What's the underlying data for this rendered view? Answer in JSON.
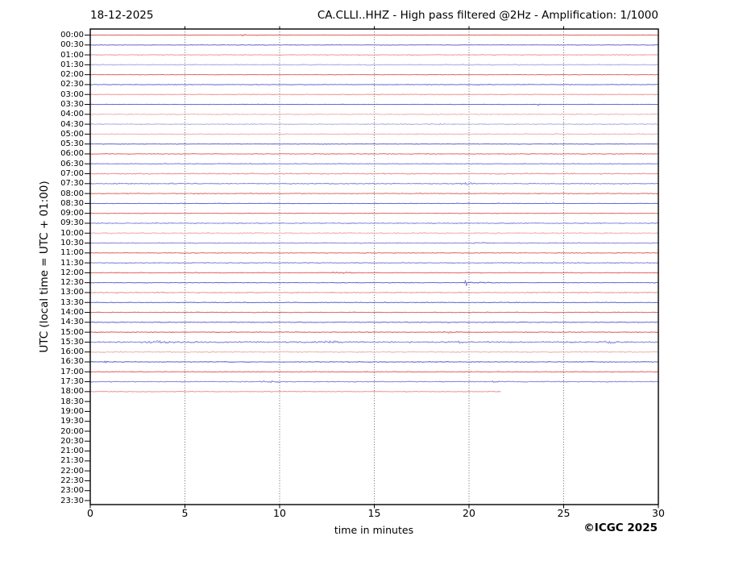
{
  "header": {
    "date": "18-12-2025",
    "title": "CA.CLLI..HHZ - High pass filtered @2Hz - Amplification: 1/1000"
  },
  "y_axis": {
    "title": "UTC (local time = UTC + 01:00)",
    "tick_labels": [
      "00:00",
      "00:30",
      "01:00",
      "01:30",
      "02:00",
      "02:30",
      "03:00",
      "03:30",
      "04:00",
      "04:30",
      "05:00",
      "05:30",
      "06:00",
      "06:30",
      "07:00",
      "07:30",
      "08:00",
      "08:30",
      "09:00",
      "09:30",
      "10:00",
      "10:30",
      "11:00",
      "11:30",
      "12:00",
      "12:30",
      "13:00",
      "13:30",
      "14:00",
      "14:30",
      "15:00",
      "15:30",
      "16:00",
      "16:30",
      "17:00",
      "17:30",
      "18:00",
      "18:30",
      "19:00",
      "19:30",
      "20:00",
      "20:30",
      "21:00",
      "21:30",
      "22:00",
      "22:30",
      "23:00",
      "23:30"
    ]
  },
  "x_axis": {
    "title": "time in minutes",
    "ticks": [
      "0",
      "5",
      "10",
      "15",
      "20",
      "25",
      "30"
    ],
    "min": 0,
    "max": 30,
    "gridlines_min": [
      5,
      10,
      15,
      20,
      25
    ]
  },
  "footer": {
    "copyright": "©ICGC 2025"
  },
  "colors": {
    "red": "#d84040",
    "midred": "#e87878",
    "pink": "#f0a0a0",
    "blue": "#4040c8",
    "midblue": "#6868d4",
    "lightblue": "#9898e0",
    "grid": "#555555",
    "axis": "#000000"
  },
  "chart_data": {
    "type": "line",
    "subtype": "helicorder-dayplot",
    "minutes_per_line": 30,
    "x_range_minutes": [
      0,
      30
    ],
    "rows": [
      {
        "label": "00:00",
        "color": "red",
        "amp": 0.45,
        "events": [
          {
            "t": 8.1,
            "s": 0.08,
            "a": 1.6
          }
        ]
      },
      {
        "label": "00:30",
        "color": "blue",
        "amp": 0.45,
        "events": [
          {
            "t": 10.85,
            "s": 0.07,
            "a": 1.8
          }
        ]
      },
      {
        "label": "01:00",
        "color": "midred",
        "amp": 0.5
      },
      {
        "label": "01:30",
        "color": "lightblue",
        "amp": 0.75
      },
      {
        "label": "02:00",
        "color": "red",
        "amp": 0.45,
        "events": [
          {
            "t": 27.0,
            "s": 0.09,
            "a": 1.1
          }
        ]
      },
      {
        "label": "02:30",
        "color": "blue",
        "amp": 0.5
      },
      {
        "label": "03:00",
        "color": "midred",
        "amp": 0.5
      },
      {
        "label": "03:30",
        "color": "blue",
        "amp": 0.45,
        "events": [
          {
            "t": 23.65,
            "s": 0.07,
            "a": 1.7
          }
        ]
      },
      {
        "label": "04:00",
        "color": "pink",
        "amp": 0.8
      },
      {
        "label": "04:30",
        "color": "lightblue",
        "amp": 0.7,
        "events": [
          {
            "t": 18.55,
            "s": 0.12,
            "a": 1.1
          }
        ]
      },
      {
        "label": "05:00",
        "color": "pink",
        "amp": 0.75
      },
      {
        "label": "05:30",
        "color": "blue",
        "amp": 0.5
      },
      {
        "label": "06:00",
        "color": "red",
        "amp": 0.55
      },
      {
        "label": "06:30",
        "color": "midblue",
        "amp": 0.65
      },
      {
        "label": "07:00",
        "color": "midred",
        "amp": 0.85
      },
      {
        "label": "07:30",
        "color": "midblue",
        "amp": 0.7,
        "events": [
          {
            "t": 4.3,
            "s": 0.08,
            "a": 0.9
          },
          {
            "t": 19.9,
            "s": 0.35,
            "a": 1.1
          }
        ]
      },
      {
        "label": "08:00",
        "color": "red",
        "amp": 0.55
      },
      {
        "label": "08:30",
        "color": "blue",
        "amp": 0.5
      },
      {
        "label": "09:00",
        "color": "red",
        "amp": 0.45
      },
      {
        "label": "09:30",
        "color": "midblue",
        "amp": 0.75
      },
      {
        "label": "10:00",
        "color": "pink",
        "amp": 0.95
      },
      {
        "label": "10:30",
        "color": "midblue",
        "amp": 0.65,
        "events": [
          {
            "t": 20.8,
            "s": 0.4,
            "a": 1.1
          }
        ]
      },
      {
        "label": "11:00",
        "color": "red",
        "amp": 0.55
      },
      {
        "label": "11:30",
        "color": "midblue",
        "amp": 0.7
      },
      {
        "label": "12:00",
        "color": "red",
        "amp": 0.6,
        "events": [
          {
            "t": 13.2,
            "s": 0.7,
            "a": 0.7
          }
        ]
      },
      {
        "label": "12:30",
        "color": "blue",
        "amp": 0.5,
        "events": [
          {
            "t": 19.85,
            "s": 0.06,
            "a": 4.2
          },
          {
            "t": 20.6,
            "s": 0.5,
            "a": 0.7
          }
        ]
      },
      {
        "label": "13:00",
        "color": "midred",
        "amp": 0.8
      },
      {
        "label": "13:30",
        "color": "blue",
        "amp": 0.55
      },
      {
        "label": "14:00",
        "color": "red",
        "amp": 0.6
      },
      {
        "label": "14:30",
        "color": "blue",
        "amp": 0.55
      },
      {
        "label": "15:00",
        "color": "red",
        "amp": 0.6,
        "events": [
          {
            "t": 19.0,
            "s": 0.5,
            "a": 0.6
          }
        ]
      },
      {
        "label": "15:30",
        "color": "midblue",
        "amp": 0.95,
        "events": [
          {
            "t": 3.6,
            "s": 0.8,
            "a": 1.1
          },
          {
            "t": 12.7,
            "s": 0.45,
            "a": 1.7
          },
          {
            "t": 19.4,
            "s": 0.4,
            "a": 0.9
          },
          {
            "t": 25.2,
            "s": 0.3,
            "a": 0.7
          },
          {
            "t": 27.4,
            "s": 0.4,
            "a": 1.1
          }
        ]
      },
      {
        "label": "16:00",
        "color": "pink",
        "amp": 0.95
      },
      {
        "label": "16:30",
        "color": "blue",
        "amp": 0.6,
        "events": [
          {
            "t": 0.95,
            "s": 0.25,
            "a": 1.5
          },
          {
            "t": 10.3,
            "s": 0.1,
            "a": 0.7
          }
        ]
      },
      {
        "label": "17:00",
        "color": "red",
        "amp": 0.6
      },
      {
        "label": "17:30",
        "color": "midblue",
        "amp": 0.7,
        "events": [
          {
            "t": 9.5,
            "s": 0.5,
            "a": 0.8
          },
          {
            "t": 21.4,
            "s": 0.3,
            "a": 0.7
          }
        ]
      },
      {
        "label": "18:00",
        "color": "midred",
        "amp": 0.5,
        "end": 0.7233
      },
      {
        "label": "18:30",
        "empty": true
      },
      {
        "label": "19:00",
        "empty": true
      },
      {
        "label": "19:30",
        "empty": true
      },
      {
        "label": "20:00",
        "empty": true
      },
      {
        "label": "20:30",
        "empty": true
      },
      {
        "label": "21:00",
        "empty": true
      },
      {
        "label": "21:30",
        "empty": true
      },
      {
        "label": "22:00",
        "empty": true
      },
      {
        "label": "22:30",
        "empty": true
      },
      {
        "label": "23:00",
        "empty": true
      },
      {
        "label": "23:30",
        "empty": true
      }
    ]
  }
}
